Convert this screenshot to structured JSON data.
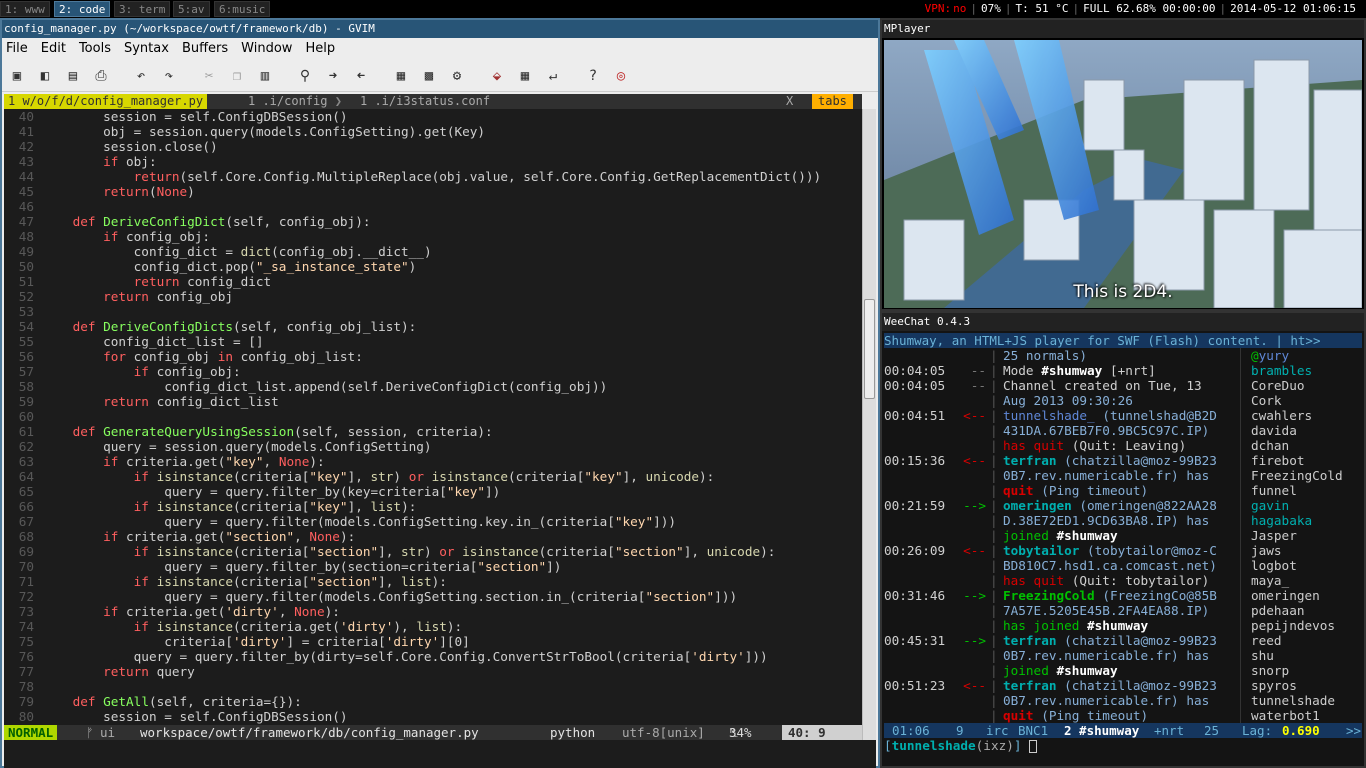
{
  "i3bar": {
    "workspaces": [
      "1: www",
      "2: code",
      "3: term",
      "5:av",
      "6:music"
    ],
    "status": {
      "vpn_label": "VPN:",
      "vpn_value": "no",
      "volume": "07%",
      "temp": "T: 51 °C",
      "battery": "FULL 62.68% 00:00:00",
      "datetime": "2014-05-12 01:06:15"
    },
    "colors": {
      "active": "#285577",
      "red": "#ff0000"
    }
  },
  "gvim": {
    "title": "config_manager.py (~/workspace/owtf/framework/db) - GVIM",
    "menu": [
      "File",
      "Edit",
      "Tools",
      "Syntax",
      "Buffers",
      "Window",
      "Help"
    ],
    "toolbar_icons": [
      "open-icon",
      "open-session-icon",
      "save-icon",
      "print-icon",
      "undo-icon",
      "redo-icon",
      "cut-icon",
      "copy-icon",
      "paste-icon",
      "find-icon",
      "find-next-icon",
      "find-prev-icon",
      "load-session-icon",
      "save-session-icon",
      "run-script-icon",
      "make-icon",
      "shell-icon",
      "tags-icon",
      "help-icon",
      "find-help-icon"
    ],
    "tabs": {
      "active": "1 w/o/f/d/config_manager.py",
      "tab2": "1 .i/config",
      "tab3": "1 .i/i3status.conf",
      "close": "X",
      "label": "tabs"
    },
    "code_lines": [
      {
        "n": "40",
        "t": "        session = self.ConfigDBSession()"
      },
      {
        "n": "41",
        "t": "        obj = session.query(models.ConfigSetting).get(Key)"
      },
      {
        "n": "42",
        "t": "        session.close()"
      },
      {
        "n": "43",
        "t": "        if obj:"
      },
      {
        "n": "44",
        "t": "            return(self.Core.Config.MultipleReplace(obj.value, self.Core.Config.GetReplacementDict()))"
      },
      {
        "n": "45",
        "t": "        return(None)"
      },
      {
        "n": "46",
        "t": ""
      },
      {
        "n": "47",
        "t": "    def DeriveConfigDict(self, config_obj):"
      },
      {
        "n": "48",
        "t": "        if config_obj:"
      },
      {
        "n": "49",
        "t": "            config_dict = dict(config_obj.__dict__)"
      },
      {
        "n": "50",
        "t": "            config_dict.pop(\"_sa_instance_state\")"
      },
      {
        "n": "51",
        "t": "            return config_dict"
      },
      {
        "n": "52",
        "t": "        return config_obj"
      },
      {
        "n": "53",
        "t": ""
      },
      {
        "n": "54",
        "t": "    def DeriveConfigDicts(self, config_obj_list):"
      },
      {
        "n": "55",
        "t": "        config_dict_list = []"
      },
      {
        "n": "56",
        "t": "        for config_obj in config_obj_list:"
      },
      {
        "n": "57",
        "t": "            if config_obj:"
      },
      {
        "n": "58",
        "t": "                config_dict_list.append(self.DeriveConfigDict(config_obj))"
      },
      {
        "n": "59",
        "t": "        return config_dict_list"
      },
      {
        "n": "60",
        "t": ""
      },
      {
        "n": "61",
        "t": "    def GenerateQueryUsingSession(self, session, criteria):"
      },
      {
        "n": "62",
        "t": "        query = session.query(models.ConfigSetting)"
      },
      {
        "n": "63",
        "t": "        if criteria.get(\"key\", None):"
      },
      {
        "n": "64",
        "t": "            if isinstance(criteria[\"key\"], str) or isinstance(criteria[\"key\"], unicode):"
      },
      {
        "n": "65",
        "t": "                query = query.filter_by(key=criteria[\"key\"])"
      },
      {
        "n": "66",
        "t": "            if isinstance(criteria[\"key\"], list):"
      },
      {
        "n": "67",
        "t": "                query = query.filter(models.ConfigSetting.key.in_(criteria[\"key\"]))"
      },
      {
        "n": "68",
        "t": "        if criteria.get(\"section\", None):"
      },
      {
        "n": "69",
        "t": "            if isinstance(criteria[\"section\"], str) or isinstance(criteria[\"section\"], unicode):"
      },
      {
        "n": "70",
        "t": "                query = query.filter_by(section=criteria[\"section\"])"
      },
      {
        "n": "71",
        "t": "            if isinstance(criteria[\"section\"], list):"
      },
      {
        "n": "72",
        "t": "                query = query.filter(models.ConfigSetting.section.in_(criteria[\"section\"]))"
      },
      {
        "n": "73",
        "t": "        if criteria.get('dirty', None):"
      },
      {
        "n": "74",
        "t": "            if isinstance(criteria.get('dirty'), list):"
      },
      {
        "n": "75",
        "t": "                criteria['dirty'] = criteria['dirty'][0]"
      },
      {
        "n": "76",
        "t": "            query = query.filter_by(dirty=self.Core.Config.ConvertStrToBool(criteria['dirty']))"
      },
      {
        "n": "77",
        "t": "        return query"
      },
      {
        "n": "78",
        "t": ""
      },
      {
        "n": "79",
        "t": "    def GetAll(self, criteria={}):"
      },
      {
        "n": "80",
        "t": "        session = self.ConfigDBSession()"
      }
    ],
    "statusline": {
      "mode": "NORMAL",
      "branch": "ui",
      "path": "workspace/owtf/framework/db/config_manager.py",
      "filetype": "python",
      "encoding": "utf-8[unix]",
      "percent": "34%",
      "position": "40:  9"
    }
  },
  "mplayer": {
    "title": "MPlayer",
    "subtitle": "This is 2D4."
  },
  "weechat": {
    "title": "WeeChat 0.4.3",
    "topic": "Shumway, an HTML+JS player for SWF (Flash) content. | ht>>",
    "lines": [
      {
        "time": "",
        "prefix": "",
        "text": "25 normals)"
      },
      {
        "time": "00:04:05",
        "prefix": "--",
        "text": "Mode #shumway [+nrt]"
      },
      {
        "time": "00:04:05",
        "prefix": "--",
        "text": "Channel created on Tue, 13"
      },
      {
        "time": "",
        "prefix": "",
        "text": "Aug 2013 09:30:26"
      },
      {
        "time": "00:04:51",
        "prefix": "<--",
        "text": "tunnelshade_ (tunnelshad@B2D"
      },
      {
        "time": "",
        "prefix": "",
        "text": "431DA.67BEB7F0.9BC5C97C.IP)"
      },
      {
        "time": "",
        "prefix": "",
        "text": "has quit (Quit: Leaving)"
      },
      {
        "time": "00:15:36",
        "prefix": "<--",
        "text": "terfran (chatzilla@moz-99B23"
      },
      {
        "time": "",
        "prefix": "",
        "text": "0B7.rev.numericable.fr) has"
      },
      {
        "time": "",
        "prefix": "",
        "text": "quit (Ping timeout)"
      },
      {
        "time": "00:21:59",
        "prefix": "-->",
        "text": "omeringen (omeringen@822AA28"
      },
      {
        "time": "",
        "prefix": "",
        "text": "D.38E72ED1.9CD63BA8.IP) has"
      },
      {
        "time": "",
        "prefix": "",
        "text": "joined #shumway"
      },
      {
        "time": "00:26:09",
        "prefix": "<--",
        "text": "tobytailor (tobytailor@moz-C"
      },
      {
        "time": "",
        "prefix": "",
        "text": "BD810C7.hsd1.ca.comcast.net)"
      },
      {
        "time": "",
        "prefix": "",
        "text": "has quit (Quit: tobytailor)"
      },
      {
        "time": "00:31:46",
        "prefix": "-->",
        "text": "FreezingCold (FreezingCo@85B"
      },
      {
        "time": "",
        "prefix": "",
        "text": "7A57E.5205E45B.2FA4EA88.IP)"
      },
      {
        "time": "",
        "prefix": "",
        "text": "has joined #shumway"
      },
      {
        "time": "00:45:31",
        "prefix": "-->",
        "text": "terfran (chatzilla@moz-99B23"
      },
      {
        "time": "",
        "prefix": "",
        "text": "0B7.rev.numericable.fr) has"
      },
      {
        "time": "",
        "prefix": "",
        "text": "joined #shumway"
      },
      {
        "time": "00:51:23",
        "prefix": "<--",
        "text": "terfran (chatzilla@moz-99B23"
      },
      {
        "time": "",
        "prefix": "",
        "text": "0B7.rev.numericable.fr) has"
      },
      {
        "time": "",
        "prefix": "",
        "text": "quit (Ping timeout)"
      }
    ],
    "nicks": [
      "@yury",
      "brambles",
      "CoreDuo",
      "Cork",
      "cwahlers",
      "davida",
      "dchan",
      "firebot",
      "FreezingCold",
      "funnel",
      "gavin",
      "hagabaka",
      "Jasper",
      "jaws",
      "logbot",
      "maya_",
      "omeringen",
      "pdehaan",
      "pepijndevos",
      "reed",
      "shu",
      "snorp",
      "spyros",
      "tunnelshade",
      "waterbot1"
    ],
    "status": {
      "time": "01:06",
      "num": "9",
      "server": "irc",
      "net": "BNC1",
      "channel": "2 #shumway",
      "modes": "+nrt",
      "count": "25",
      "lag_label": "Lag:",
      "lag": "0.690",
      "more": ">>"
    },
    "input_nick": "tunnelshade",
    "input_mode": "(ixz)"
  }
}
